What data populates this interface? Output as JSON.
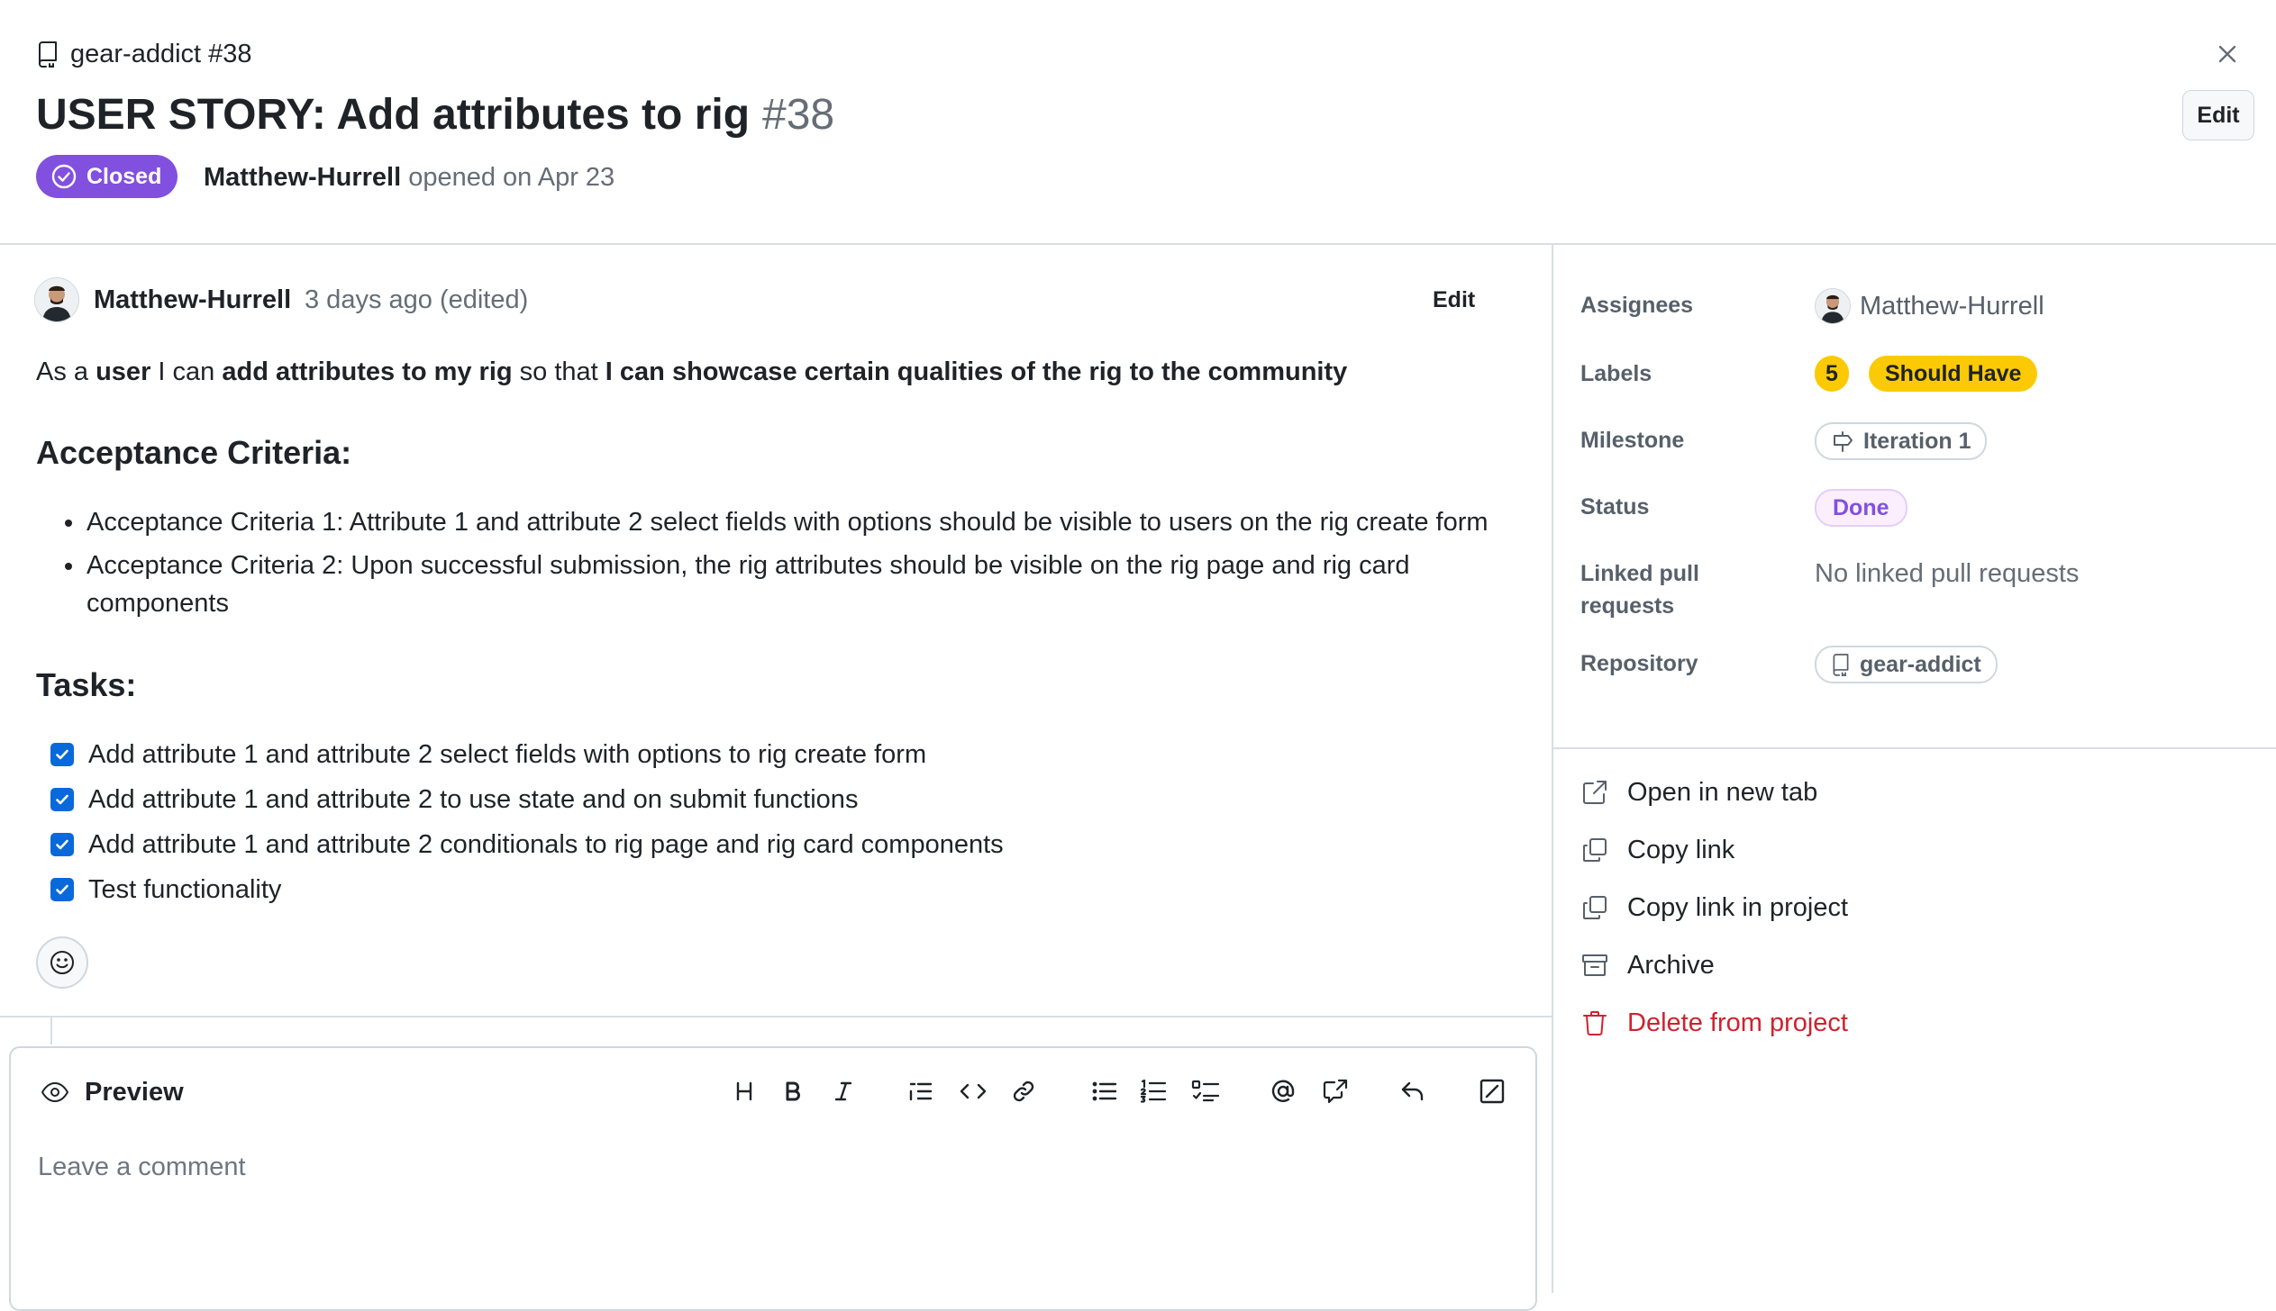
{
  "header": {
    "repo_ref": "gear-addict #38",
    "title": "USER STORY: Add attributes to rig",
    "issue_number": "#38",
    "state": "Closed",
    "author": "Matthew-Hurrell",
    "opened_text": "opened on Apr 23",
    "edit_label": "Edit"
  },
  "comment": {
    "author": "Matthew-Hurrell",
    "time": "3 days ago (edited)",
    "edit_label": "Edit",
    "story": {
      "p1": "As a ",
      "b1": "user",
      "p2": " I can ",
      "b2": "add attributes to my rig",
      "p3": " so that ",
      "b3": "I can showcase certain qualities of the rig to the community"
    },
    "acceptance_heading": "Acceptance Criteria:",
    "acceptance_items": [
      "Acceptance Criteria 1: Attribute 1 and attribute 2 select fields with options should be visible to users on the rig create form",
      "Acceptance Criteria 2: Upon successful submission, the rig attributes should be visible on the rig page and rig card components"
    ],
    "tasks_heading": "Tasks:",
    "tasks": [
      {
        "label": "Add attribute 1 and attribute 2 select fields with options to rig create form",
        "checked": true
      },
      {
        "label": "Add attribute 1 and attribute 2 to use state and on submit functions",
        "checked": true
      },
      {
        "label": "Add attribute 1 and attribute 2 conditionals to rig page and rig card components",
        "checked": true
      },
      {
        "label": "Test functionality",
        "checked": true
      }
    ]
  },
  "editor": {
    "tab_label": "Preview",
    "placeholder": "Leave a comment",
    "toolbar": [
      "heading-icon",
      "bold-icon",
      "italic-icon",
      "quote-icon",
      "code-icon",
      "link-icon",
      "bulleted-list-icon",
      "numbered-list-icon",
      "task-list-icon",
      "mention-icon",
      "cross-reference-icon",
      "reply-icon",
      "fullscreen-icon"
    ]
  },
  "sidebar": {
    "assignees_label": "Assignees",
    "assignee": "Matthew-Hurrell",
    "labels_label": "Labels",
    "labels": [
      "5",
      "Should Have"
    ],
    "label_color": "#fbca04",
    "milestone_label": "Milestone",
    "milestone": "Iteration 1",
    "status_label": "Status",
    "status": "Done",
    "status_color": "#8250df",
    "linked_label": "Linked pull requests",
    "linked_value": "No linked pull requests",
    "repository_label": "Repository",
    "repository": "gear-addict",
    "actions": [
      {
        "label": "Open in new tab",
        "icon": "external-link-icon"
      },
      {
        "label": "Copy link",
        "icon": "copy-icon"
      },
      {
        "label": "Copy link in project",
        "icon": "copy-icon"
      },
      {
        "label": "Archive",
        "icon": "archive-icon"
      },
      {
        "label": "Delete from project",
        "icon": "trash-icon",
        "danger": true
      }
    ]
  },
  "colors": {
    "closed_badge": "#8250df",
    "checkbox": "#0969da",
    "danger": "#cf222e"
  }
}
